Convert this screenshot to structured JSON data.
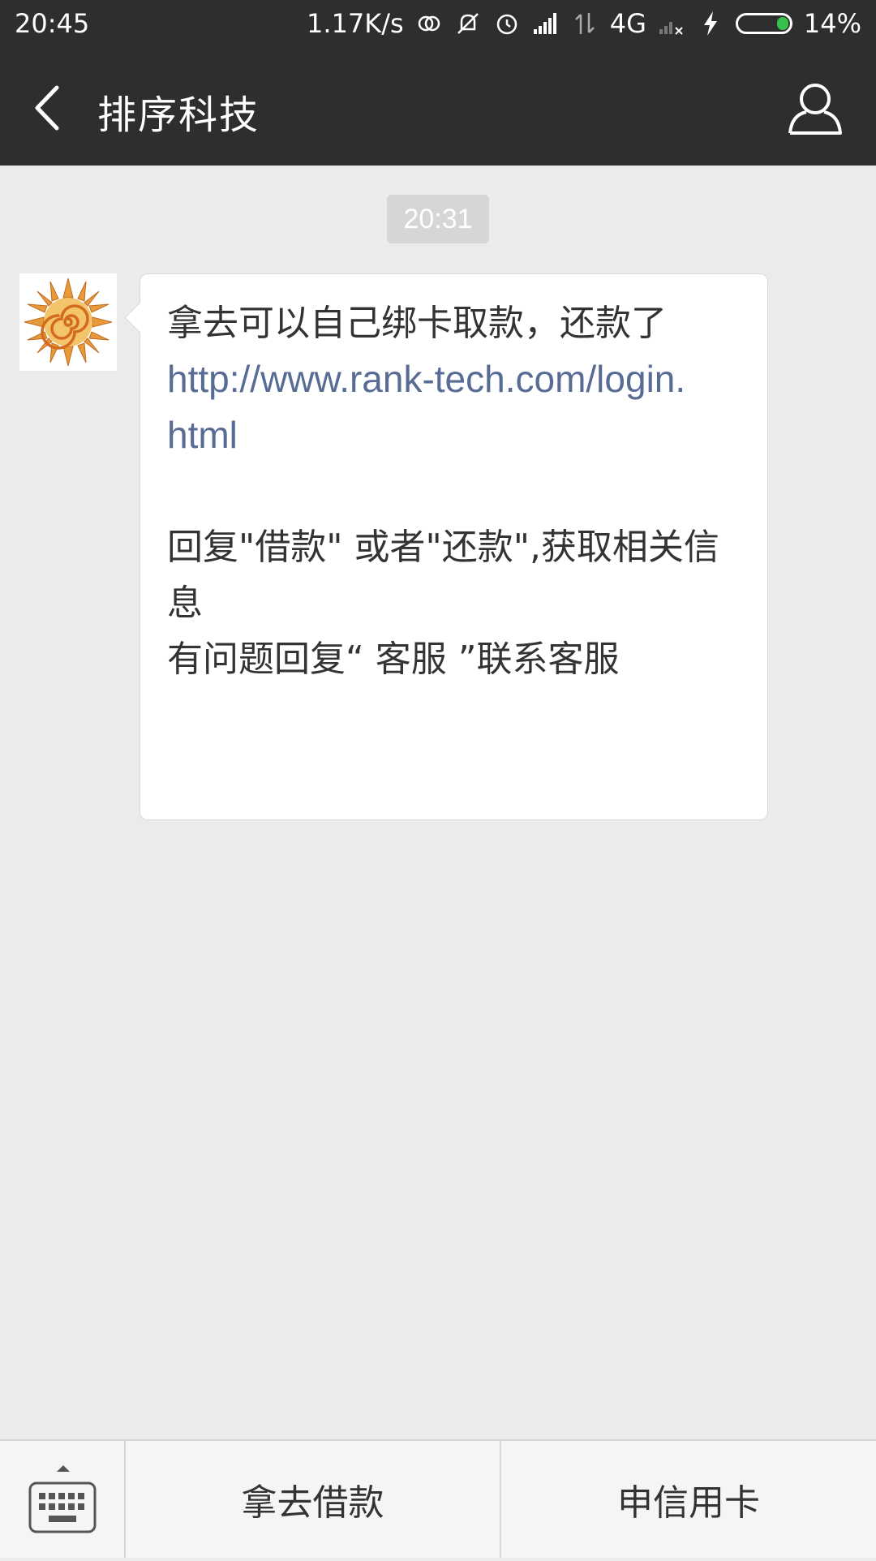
{
  "status_bar": {
    "time": "20:45",
    "network_speed": "1.17K/s",
    "network_type": "4G",
    "battery": "14%",
    "icons": [
      "sync-icon",
      "mute-icon",
      "alarm-icon",
      "signal-icon",
      "data-arrows-icon",
      "signal-no-sim-icon",
      "charging-icon",
      "battery-icon"
    ]
  },
  "header": {
    "title": "排序科技",
    "back_icon": "back-chevron-icon",
    "profile_icon": "person-icon"
  },
  "chat": {
    "timestamp": "20:31",
    "message": {
      "line1": "拿去可以自己绑卡取款，还款了",
      "link_line1": "http://www.rank-tech.com/login.",
      "link_line2": "html",
      "line3": "回复\"借款\" 或者\"还款\",获取相关信",
      "line4": "息",
      "line5": "有问题回复“ 客服 ”联系客服"
    },
    "avatar_icon": "sun-logo-icon"
  },
  "bottom_menu": {
    "keyboard_icon": "keyboard-icon",
    "items": [
      {
        "label": "拿去借款"
      },
      {
        "label": "申信用卡"
      }
    ]
  },
  "colors": {
    "header_bg": "#2e2e2e",
    "chat_bg": "#ebebeb",
    "link": "#576b95",
    "battery_fill": "#36c24a"
  }
}
